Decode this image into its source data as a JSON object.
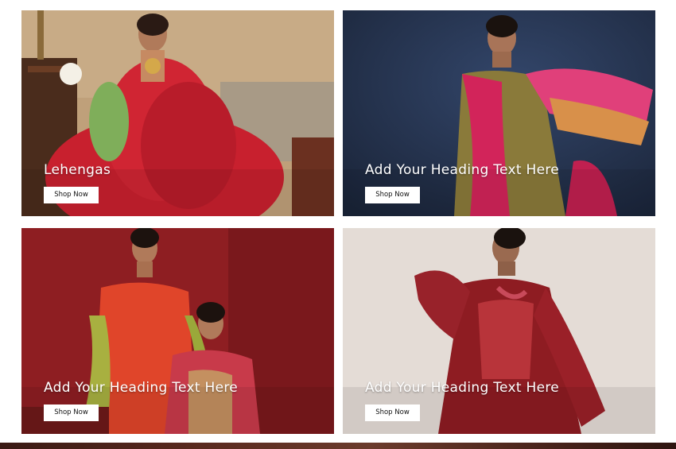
{
  "cards": [
    {
      "heading": "Lehengas",
      "button_label": "Shop Now",
      "photo": "bridal-lehenga-photo"
    },
    {
      "heading": "Add Your Heading Text Here",
      "button_label": "Shop Now",
      "photo": "pink-dupatta-photo"
    },
    {
      "heading": "Add Your Heading Text Here",
      "button_label": "Shop Now",
      "photo": "two-models-red-photo"
    },
    {
      "heading": "Add Your Heading Text Here",
      "button_label": "Shop Now",
      "photo": "maroon-kurta-photo"
    }
  ],
  "colors": {
    "button_bg": "#ffffff",
    "heading_text": "#ffffff"
  }
}
